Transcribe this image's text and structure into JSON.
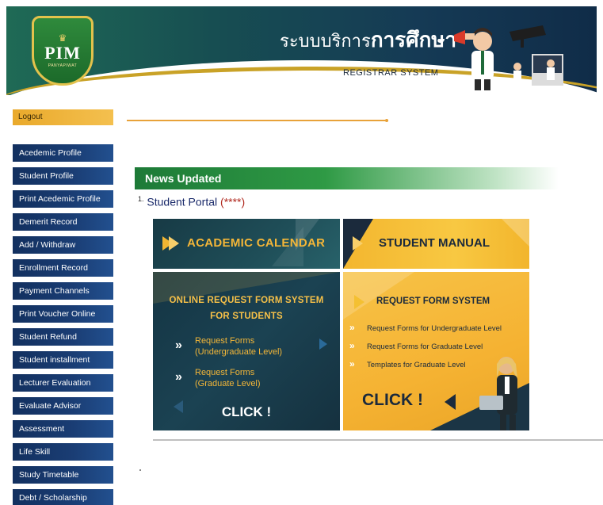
{
  "header": {
    "logo_text": "PIM",
    "logo_sub": "PANYAPIWAT",
    "title_thai_prefix": "ระบบบริการ",
    "title_thai_main": "การศึกษา",
    "title_en": "REGISTRAR SYSTEM"
  },
  "sidebar": {
    "logout_label": "Logout",
    "items": [
      {
        "label": "Acedemic Profile"
      },
      {
        "label": "Student Profile"
      },
      {
        "label": "Print Acedemic Profile"
      },
      {
        "label": "Demerit Record"
      },
      {
        "label": "Add / Withdraw"
      },
      {
        "label": "Enrollment Record"
      },
      {
        "label": "Payment Channels"
      },
      {
        "label": "Print Voucher Online"
      },
      {
        "label": "Student Refund"
      },
      {
        "label": "Student installment"
      },
      {
        "label": "Lecturer Evaluation"
      },
      {
        "label": "Evaluate Advisor"
      },
      {
        "label": "Assessment"
      },
      {
        "label": "Life Skill"
      },
      {
        "label": "Study Timetable"
      },
      {
        "label": "Debt / Scholarship"
      }
    ]
  },
  "news": {
    "heading": "News Updated",
    "item_number": "1.",
    "item_link": "Student Portal",
    "item_stars": "(****)"
  },
  "tiles": {
    "academic_calendar": "ACADEMIC CALENDAR",
    "student_manual": "STUDENT MANUAL",
    "online_form": {
      "title_line1": "ONLINE REQUEST FORM SYSTEM",
      "title_line2": "FOR STUDENTS",
      "link1_line1": "Request Forms",
      "link1_line2": "(Undergraduate Level)",
      "link2_line1": "Request Forms",
      "link2_line2": "(Graduate Level)",
      "link_marker": "»",
      "click": "CLICK !"
    },
    "request_form": {
      "title": "REQUEST FORM SYSTEM",
      "link1": "Request Forms for Undergraduate Level",
      "link2": "Request Forms for Graduate Level",
      "link3": "Templates for Graduate Level",
      "link_marker": "»",
      "click": "CLICK !"
    }
  },
  "colors": {
    "menu_navy": "#12305f",
    "logout_orange": "#e9a92b",
    "news_green": "#1d7a37",
    "accent_yellow": "#f6c048"
  }
}
